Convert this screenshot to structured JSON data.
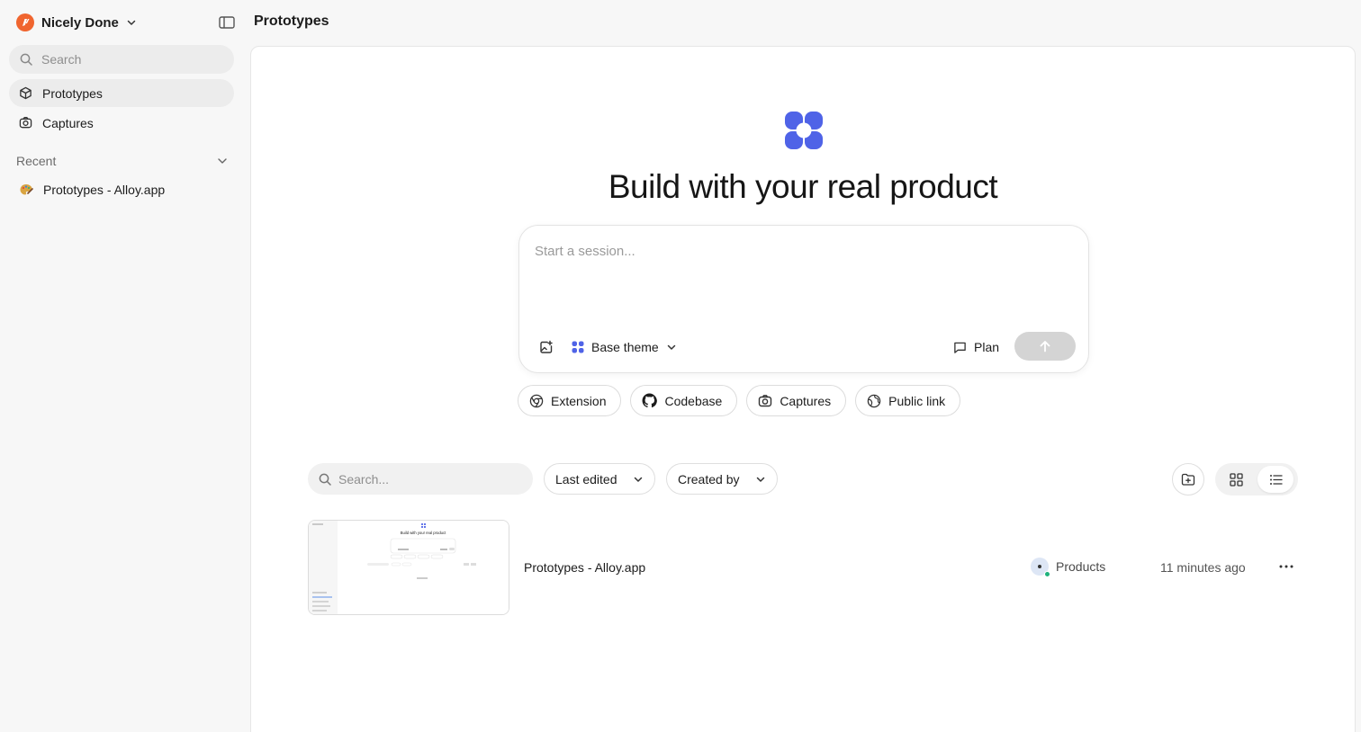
{
  "sidebar": {
    "workspace_name": "Nicely Done",
    "search_placeholder": "Search",
    "nav": [
      {
        "label": "Prototypes",
        "icon": "cube-icon",
        "active": true
      },
      {
        "label": "Captures",
        "icon": "camera-icon",
        "active": false
      }
    ],
    "recent_label": "Recent",
    "recent_items": [
      {
        "label": "Prototypes - Alloy.app",
        "icon": "palette-icon"
      }
    ]
  },
  "header": {
    "title": "Prototypes"
  },
  "hero": {
    "title": "Build with your real product",
    "composer_placeholder": "Start a session...",
    "theme_label": "Base theme",
    "plan_label": "Plan",
    "chips": [
      {
        "label": "Extension",
        "icon": "chrome-icon"
      },
      {
        "label": "Codebase",
        "icon": "github-icon"
      },
      {
        "label": "Captures",
        "icon": "camera-icon"
      },
      {
        "label": "Public link",
        "icon": "globe-icon"
      }
    ]
  },
  "toolbar": {
    "search_placeholder": "Search...",
    "sort_label": "Last edited",
    "creator_label": "Created by",
    "view_mode": "list"
  },
  "prototypes": [
    {
      "name": "Prototypes - Alloy.app",
      "owner": "Products",
      "updated": "11 minutes ago",
      "thumbnail_title": "Build with your real product"
    }
  ],
  "colors": {
    "brand_orange": "#f0652f",
    "accent_blue": "#4f63e7",
    "online_green": "#1fb27c",
    "send_disabled": "#d4d4d4"
  }
}
